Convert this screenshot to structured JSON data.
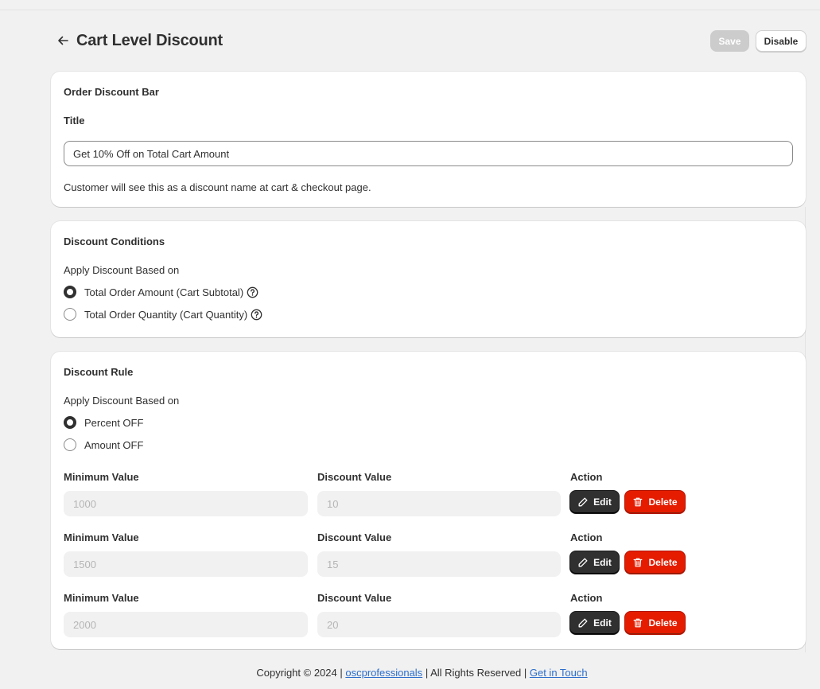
{
  "header": {
    "title": "Cart Level Discount",
    "save_label": "Save",
    "disable_label": "Disable"
  },
  "order_discount_bar": {
    "heading": "Order Discount Bar",
    "title_label": "Title",
    "title_value": "Get 10% Off on Total Cart Amount",
    "help_text": "Customer will see this as a discount name at cart & checkout page."
  },
  "discount_conditions": {
    "heading": "Discount Conditions",
    "apply_label": "Apply Discount Based on",
    "options": [
      {
        "label": "Total Order Amount (Cart Subtotal)",
        "checked": true
      },
      {
        "label": "Total Order Quantity (Cart Quantity)",
        "checked": false
      }
    ]
  },
  "discount_rule": {
    "heading": "Discount Rule",
    "apply_label": "Apply Discount Based on",
    "options": [
      {
        "label": "Percent OFF",
        "checked": true
      },
      {
        "label": "Amount OFF",
        "checked": false
      }
    ],
    "columns": {
      "min_label": "Minimum Value",
      "discount_label": "Discount Value",
      "action_label": "Action"
    },
    "edit_label": "Edit",
    "delete_label": "Delete",
    "rows": [
      {
        "min": "1000",
        "discount": "10"
      },
      {
        "min": "1500",
        "discount": "15"
      },
      {
        "min": "2000",
        "discount": "20"
      }
    ]
  },
  "footer": {
    "prefix": "Copyright © 2024 |",
    "company_link": "oscprofessionals",
    "middle": "| All Rights Reserved |",
    "contact_link": "Get in Touch"
  },
  "colors": {
    "primary_button": "#303030",
    "delete_button": "#e51c00",
    "link": "#2c6ecb",
    "save_disabled": "#cccccc"
  },
  "icons": {
    "back": "arrow-left-icon",
    "help": "question-circle-icon",
    "edit": "pencil-icon",
    "delete": "trash-icon"
  }
}
